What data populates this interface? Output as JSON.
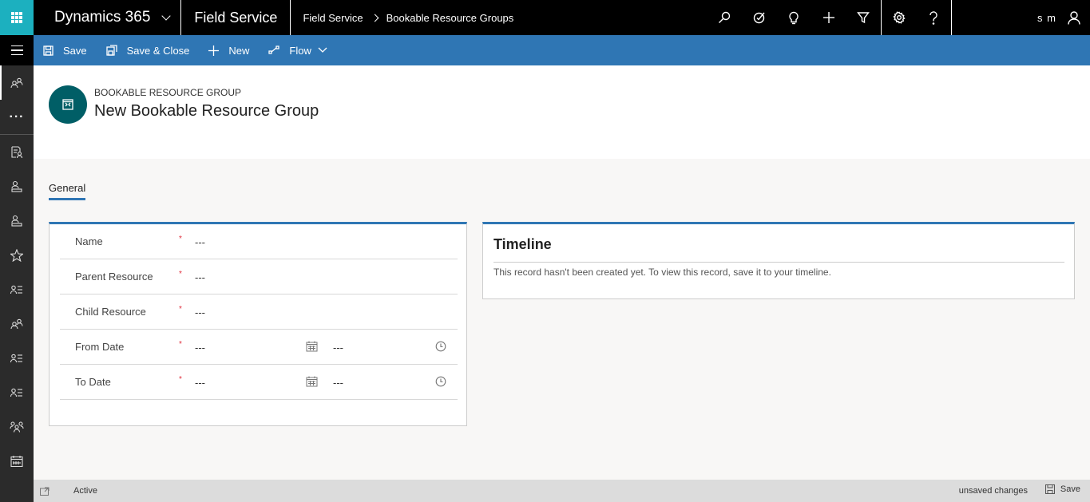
{
  "topbar": {
    "app_name": "Dynamics 365",
    "module": "Field Service",
    "breadcrumb": [
      "Field Service",
      "Bookable Resource Groups"
    ],
    "icons": [
      "search-icon",
      "task-icon",
      "lightbulb-icon",
      "plus-icon",
      "filter-icon",
      "gear-icon",
      "help-icon"
    ],
    "user_initials": "s m"
  },
  "commands": {
    "save": "Save",
    "save_close": "Save & Close",
    "new": "New",
    "flow": "Flow"
  },
  "sidebar": {
    "items": [
      "resources-icon",
      "more-icon",
      "resource-requirements-icon",
      "bookable-resource-icon",
      "resource-icon",
      "favorites-icon",
      "resource-list-icon",
      "resource-groups-icon",
      "resource-list-icon",
      "resource-list-icon",
      "team-icon",
      "calendar-icon"
    ]
  },
  "header": {
    "entity_type": "BOOKABLE RESOURCE GROUP",
    "title": "New Bookable Resource Group"
  },
  "tabs": [
    {
      "label": "General",
      "active": true
    }
  ],
  "form": {
    "fields": [
      {
        "label": "Name",
        "required": true,
        "value": "---"
      },
      {
        "label": "Parent Resource",
        "required": true,
        "value": "---"
      },
      {
        "label": "Child Resource",
        "required": true,
        "value": "---"
      },
      {
        "label": "From Date",
        "required": true,
        "value": "---",
        "time": "---"
      },
      {
        "label": "To Date",
        "required": true,
        "value": "---",
        "time": "---"
      }
    ],
    "required_marker": "*"
  },
  "timeline": {
    "title": "Timeline",
    "message": "This record hasn't been created yet.  To view this record, save it to your timeline."
  },
  "statusbar": {
    "status": "Active",
    "unsaved": "unsaved changes",
    "save": "Save"
  },
  "colors": {
    "accent": "#2f76b4",
    "waffle": "#1cb0bf",
    "avatar": "#005e66",
    "required": "#e0303e"
  }
}
